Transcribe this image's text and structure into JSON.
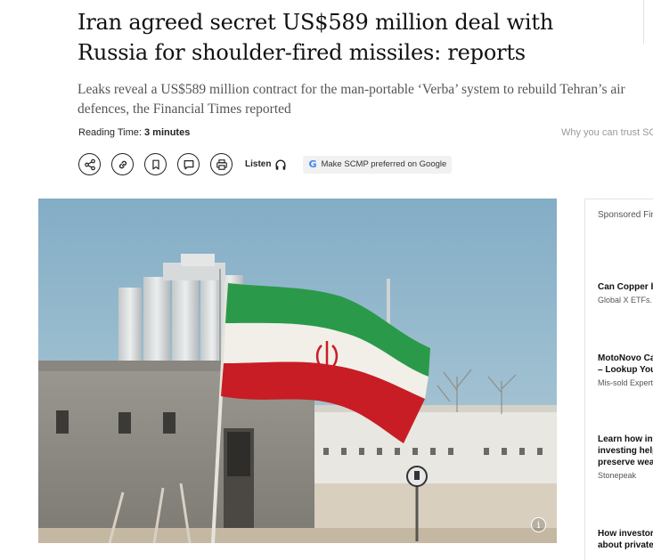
{
  "article": {
    "headline": "Iran agreed secret US$589 million deal with Russia for shoulder-fired missiles: reports",
    "subheadline": "Leaks reveal a US$589 million contract for the man-portable ‘Verba’ system to rebuild Tehran’s air defences, the Financial Times reported",
    "reading_label": "Reading Time: ",
    "reading_value": "3 minutes",
    "trust_label": "Why you can trust SCMP"
  },
  "toolbar": {
    "listen_label": "Listen",
    "google_label": "Make SCMP preferred on Google",
    "icons": [
      "share-icon",
      "link-icon",
      "bookmark-icon",
      "comment-icon",
      "print-icon",
      "headphones-icon",
      "google-icon"
    ]
  },
  "image": {
    "info_label": "i"
  },
  "sidebar": {
    "title": "Sponsored Financial Content",
    "ads": [
      {
        "title_lines": [
          "Can Copper be"
        ],
        "source": "Global X ETFs."
      },
      {
        "title_lines": [
          "MotoNovo Car",
          "– Lookup Your"
        ],
        "source": "Mis-sold Expert"
      },
      {
        "title_lines": [
          "Learn how infr",
          "investing help",
          "preserve wealt"
        ],
        "source": "Stonepeak"
      },
      {
        "title_lines": [
          "How investors",
          "about private r"
        ],
        "source": ""
      }
    ]
  },
  "colors": {
    "flag_green": "#239f40",
    "flag_red": "#da0000",
    "sky": "#8fb4c8"
  }
}
